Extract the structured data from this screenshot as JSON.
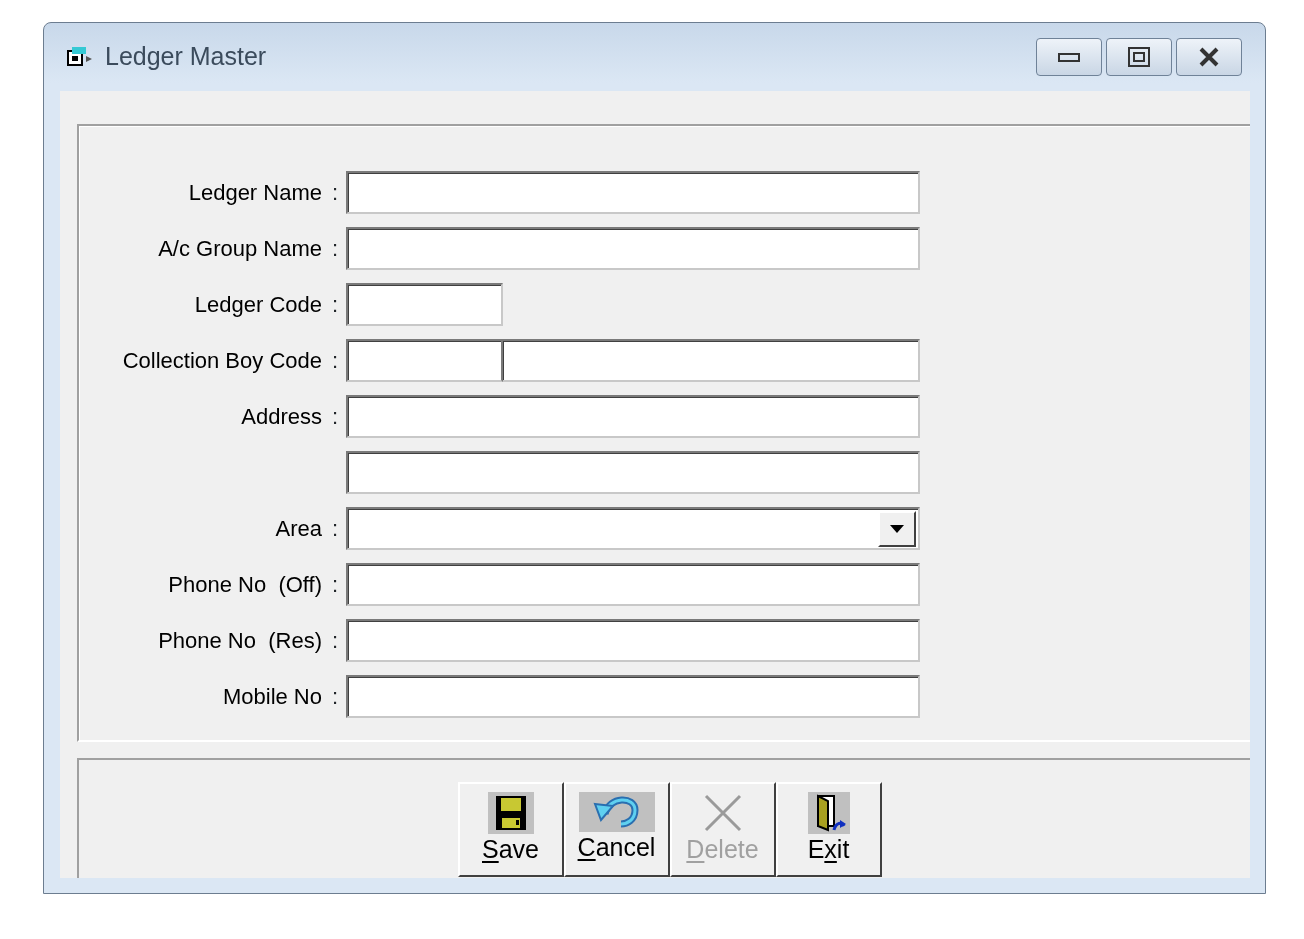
{
  "window": {
    "title": "Ledger Master"
  },
  "fields": [
    {
      "kind": "text",
      "label": "Ledger Name",
      "separator": ":"
    },
    {
      "kind": "text",
      "label": "A/c Group Name",
      "separator": ":"
    },
    {
      "kind": "short",
      "label": "Ledger Code",
      "separator": ":"
    },
    {
      "kind": "split",
      "label": "Collection Boy Code",
      "separator": ":"
    },
    {
      "kind": "text",
      "label": "Address",
      "separator": ":"
    },
    {
      "kind": "text"
    },
    {
      "kind": "dropdown",
      "label": "Area",
      "separator": ":"
    },
    {
      "kind": "text",
      "label": "Phone No  (Off)",
      "separator": ":"
    },
    {
      "kind": "text",
      "label": "Phone No  (Res)",
      "separator": ":"
    },
    {
      "kind": "text",
      "label": "Mobile No",
      "separator": ":"
    }
  ],
  "buttons": [
    {
      "kind": "save",
      "label": [
        {
          "text": "S",
          "underlined": true
        },
        {
          "text": "ave",
          "underlined": false
        }
      ],
      "disabled": false
    },
    {
      "kind": "cancel",
      "label": [
        {
          "text": "C",
          "underlined": true
        },
        {
          "text": "ancel",
          "underlined": false
        }
      ],
      "disabled": false
    },
    {
      "kind": "delete",
      "label": [
        {
          "text": "D",
          "underlined": true
        },
        {
          "text": "elete",
          "underlined": false
        }
      ],
      "disabled": true
    },
    {
      "kind": "exit",
      "label": [
        {
          "text": "E",
          "underlined": false
        },
        {
          "text": "x",
          "underlined": true
        },
        {
          "text": "it",
          "underlined": false
        }
      ],
      "disabled": false
    }
  ]
}
